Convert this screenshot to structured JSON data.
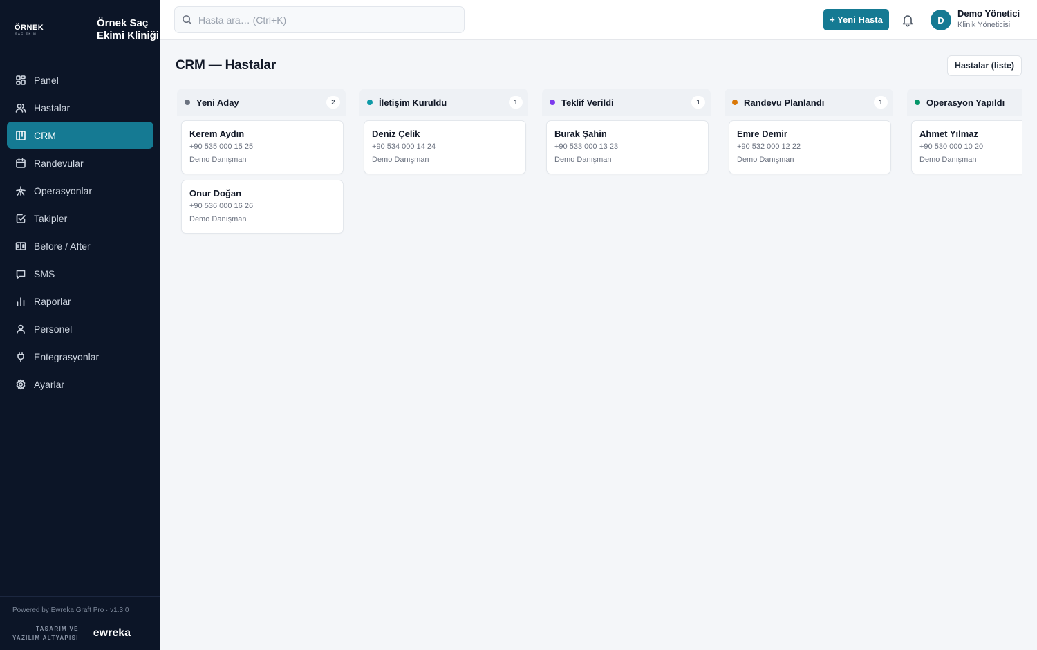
{
  "sidebar": {
    "logo_main": "ÖRNEK",
    "logo_sub": "SAÇ EKİMİ",
    "clinic_name": "Örnek Saç Ekimi Kliniği",
    "items": [
      {
        "label": "Panel",
        "icon": "grid-icon",
        "active": false
      },
      {
        "label": "Hastalar",
        "icon": "users-icon",
        "active": false
      },
      {
        "label": "CRM",
        "icon": "kanban-icon",
        "active": true
      },
      {
        "label": "Randevular",
        "icon": "calendar-icon",
        "active": false
      },
      {
        "label": "Operasyonlar",
        "icon": "syringe-icon",
        "active": false
      },
      {
        "label": "Takipler",
        "icon": "checkbox-icon",
        "active": false
      },
      {
        "label": "Before / After",
        "icon": "compare-icon",
        "active": false
      },
      {
        "label": "SMS",
        "icon": "message-icon",
        "active": false
      },
      {
        "label": "Raporlar",
        "icon": "bar-chart-icon",
        "active": false
      },
      {
        "label": "Personel",
        "icon": "user-icon",
        "active": false
      },
      {
        "label": "Entegrasyonlar",
        "icon": "plug-icon",
        "active": false
      },
      {
        "label": "Ayarlar",
        "icon": "gear-icon",
        "active": false
      }
    ],
    "footer": {
      "powered": "Powered by Ewreka Graft Pro · v1.3.0",
      "design_line1": "TASARIM VE",
      "design_line2": "YAZILIM ALTYAPISI",
      "brand": "ewreka"
    }
  },
  "topbar": {
    "search_placeholder": "Hasta ara… (Ctrl+K)",
    "new_patient": "+ Yeni Hasta",
    "user": {
      "initial": "D",
      "name": "Demo Yönetici",
      "role": "Klinik Yöneticisi"
    }
  },
  "main": {
    "title": "CRM — Hastalar",
    "list_button": "Hastalar (liste)",
    "columns": [
      {
        "title": "Yeni Aday",
        "count": "2",
        "color": "#6b7280",
        "cards": [
          {
            "name": "Kerem Aydın",
            "phone": "+90 535 000 15 25",
            "agent": "Demo Danışman"
          },
          {
            "name": "Onur Doğan",
            "phone": "+90 536 000 16 26",
            "agent": "Demo Danışman"
          }
        ]
      },
      {
        "title": "İletişim Kuruldu",
        "count": "1",
        "color": "#0e9aa7",
        "cards": [
          {
            "name": "Deniz Çelik",
            "phone": "+90 534 000 14 24",
            "agent": "Demo Danışman"
          }
        ]
      },
      {
        "title": "Teklif Verildi",
        "count": "1",
        "color": "#7c3aed",
        "cards": [
          {
            "name": "Burak Şahin",
            "phone": "+90 533 000 13 23",
            "agent": "Demo Danışman"
          }
        ]
      },
      {
        "title": "Randevu Planlandı",
        "count": "1",
        "color": "#d97706",
        "cards": [
          {
            "name": "Emre Demir",
            "phone": "+90 532 000 12 22",
            "agent": "Demo Danışman"
          }
        ]
      },
      {
        "title": "Operasyon Yapıldı",
        "count": "",
        "color": "#059669",
        "cards": [
          {
            "name": "Ahmet Yılmaz",
            "phone": "+90 530 000 10 20",
            "agent": "Demo Danışman"
          }
        ]
      }
    ]
  }
}
